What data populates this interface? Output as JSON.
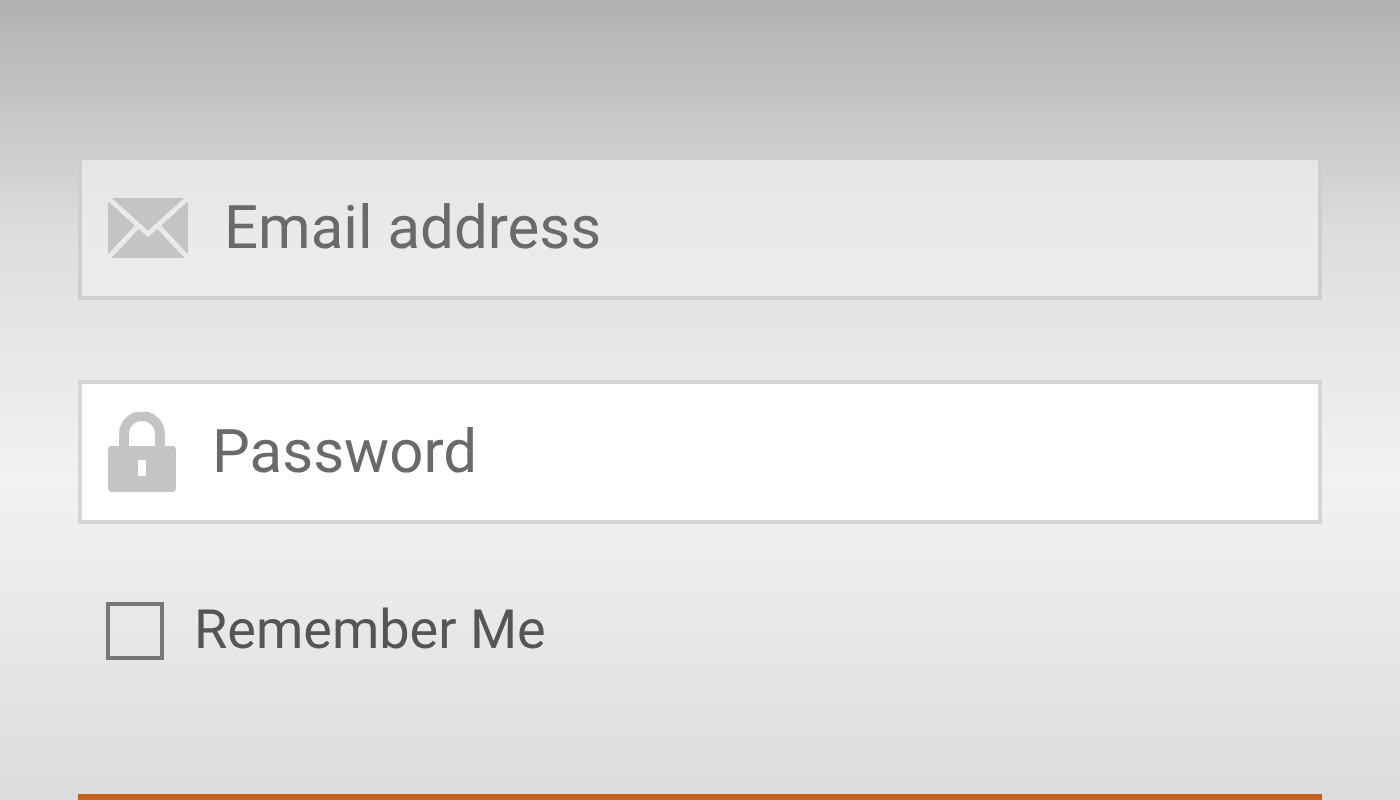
{
  "form": {
    "email": {
      "placeholder": "Email address"
    },
    "password": {
      "placeholder": "Password"
    },
    "remember_me": {
      "label": "Remember Me",
      "checked": false
    }
  }
}
